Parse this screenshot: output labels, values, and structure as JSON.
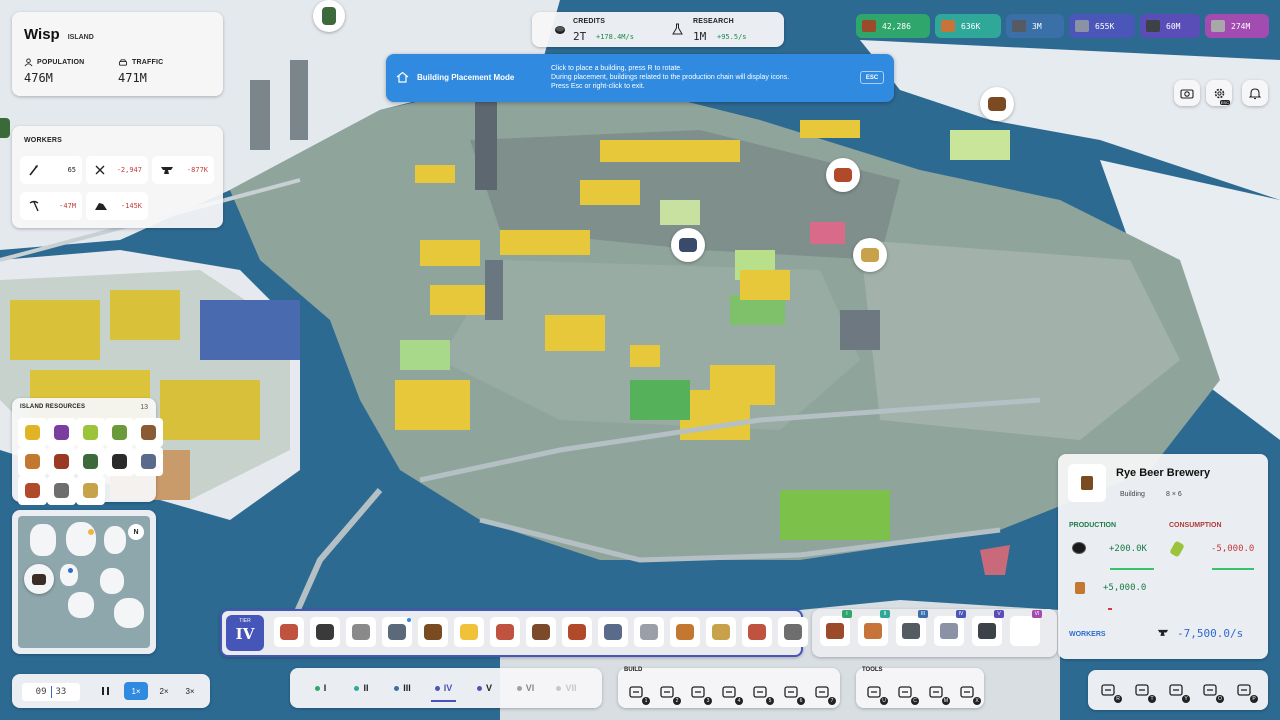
{
  "island": {
    "name": "Wisp",
    "type": "ISLAND",
    "population_label": "POPULATION",
    "population": "476M",
    "traffic_label": "TRAFFIC",
    "traffic": "471M"
  },
  "economy": {
    "credits_label": "CREDITS",
    "credits": "2T",
    "credits_rate": "+178.4M/s",
    "research_label": "RESEARCH",
    "research": "1M",
    "research_rate": "+95.5/s"
  },
  "resources": [
    {
      "value": "42,286",
      "color": "#2fa66b",
      "icon_color": "#9b4a2a",
      "icon": "log-icon"
    },
    {
      "value": "636K",
      "color": "#2fa89a",
      "icon_color": "#c7743a",
      "icon": "planks-icon"
    },
    {
      "value": "3M",
      "color": "#3a6fa8",
      "icon_color": "#555b63",
      "icon": "iron-block-icon"
    },
    {
      "value": "655K",
      "color": "#4b57b8",
      "icon_color": "#8c92a6",
      "icon": "frame-icon"
    },
    {
      "value": "60M",
      "color": "#5b4db8",
      "icon_color": "#3d4249",
      "icon": "steel-beam-icon"
    },
    {
      "value": "274M",
      "color": "#a24bb0",
      "icon_color": "#a8a8a8",
      "icon": "gear-block-icon"
    }
  ],
  "placement": {
    "title": "Building Placement Mode",
    "line1": "Click to place a building, press R to rotate.",
    "line2": "During placement, buildings related to the production chain will display icons.",
    "line3": "Press Esc or right-click to exit.",
    "esc": "ESC"
  },
  "workers": {
    "title": "WORKERS",
    "items": [
      {
        "value": "65",
        "icon": "feather-icon",
        "color": "#222"
      },
      {
        "value": "-2,947",
        "icon": "tools-icon",
        "color": "#c53b3b"
      },
      {
        "value": "-877K",
        "icon": "anvil-icon",
        "color": "#c53b3b"
      },
      {
        "value": "-47M",
        "icon": "pickaxe-icon",
        "color": "#c53b3b"
      },
      {
        "value": "-145K",
        "icon": "ore-pile-icon",
        "color": "#c53b3b"
      }
    ]
  },
  "island_resources": {
    "title": "ISLAND RESOURCES",
    "count": "13",
    "items": [
      {
        "icon": "corn-icon",
        "color": "#e0b424"
      },
      {
        "icon": "grapes-icon",
        "color": "#7a3da0"
      },
      {
        "icon": "wheat-icon",
        "color": "#9cc43a"
      },
      {
        "icon": "herb-icon",
        "color": "#6a9a3a"
      },
      {
        "icon": "wood-log-icon",
        "color": "#8a5a35"
      },
      {
        "icon": "food-bowl-icon",
        "color": "#c2782f"
      },
      {
        "icon": "cocoa-icon",
        "color": "#9a3a25"
      },
      {
        "icon": "barrel-icon",
        "color": "#3d6a3a"
      },
      {
        "icon": "coal-icon",
        "color": "#2a2a2a"
      },
      {
        "icon": "silver-ore-icon",
        "color": "#5a6a8a"
      },
      {
        "icon": "copper-ore-icon",
        "color": "#b04a2a"
      },
      {
        "icon": "stone-icon",
        "color": "#6e6e6e"
      },
      {
        "icon": "gold-ore-icon",
        "color": "#c8a24a"
      }
    ]
  },
  "minimap": {
    "compass": "N"
  },
  "building_info": {
    "name": "Rye Beer Brewery",
    "category": "Building",
    "size": "8 × 6",
    "production_label": "PRODUCTION",
    "consumption_label": "CONSUMPTION",
    "production": [
      {
        "value": "+200.0K",
        "icon": "coal-icon",
        "color": "#1d7a4a"
      },
      {
        "value": "+5,000.0",
        "icon": "beer-icon",
        "color": "#1d7a4a"
      }
    ],
    "consumption": [
      {
        "value": "-5,000.0",
        "icon": "rye-icon",
        "color": "#c53b3b"
      }
    ],
    "workers_label": "WORKERS",
    "workers_value": "-7,500.0/s"
  },
  "build_tier": {
    "label": "TIER",
    "value": "IV"
  },
  "build_items": [
    {
      "icon": "meat-icon",
      "color": "#c0533f"
    },
    {
      "icon": "tools-icon",
      "color": "#3a3a3a"
    },
    {
      "icon": "oven-icon",
      "color": "#8a8a8a"
    },
    {
      "icon": "anchor-icon",
      "color": "#5a6a7a"
    },
    {
      "icon": "beer-mug-icon",
      "color": "#7a4a20"
    },
    {
      "icon": "cheese-icon",
      "color": "#f0c23a"
    },
    {
      "icon": "leather-icon",
      "color": "#c0533f"
    },
    {
      "icon": "barrel-icon",
      "color": "#7a4a2a"
    },
    {
      "icon": "bricks-icon",
      "color": "#b04a2a"
    },
    {
      "icon": "jar-icon",
      "color": "#5a6a8a"
    },
    {
      "icon": "teapot-icon",
      "color": "#9aa0a8"
    },
    {
      "icon": "bread-icon",
      "color": "#c2782f"
    },
    {
      "icon": "pie-icon",
      "color": "#c8a24a"
    },
    {
      "icon": "cake-icon",
      "color": "#c0533f"
    },
    {
      "icon": "castle-icon",
      "color": "#6e6e6e"
    }
  ],
  "construction_items": [
    {
      "icon": "log-icon",
      "color": "#9b4a2a",
      "num": "I"
    },
    {
      "icon": "planks-icon",
      "color": "#c7743a",
      "num": "II"
    },
    {
      "icon": "iron-block-icon",
      "color": "#555b63",
      "num": "III"
    },
    {
      "icon": "frame-icon",
      "color": "#8c92a6",
      "num": "IV"
    },
    {
      "icon": "steel-beam-icon",
      "color": "#3d4249",
      "num": "V"
    },
    {
      "icon": "empty-slot-icon",
      "color": "#ffffff",
      "num": "VI"
    }
  ],
  "time": {
    "day": "09",
    "minute": "33"
  },
  "speeds": [
    "1×",
    "2×",
    "3×"
  ],
  "tiers": [
    "I",
    "II",
    "III",
    "IV",
    "V",
    "VI",
    "VII"
  ],
  "build_menu": {
    "label": "BUILD",
    "hotkeys": [
      "1",
      "2",
      "3",
      "4",
      "5",
      "6",
      "7"
    ]
  },
  "tools_menu": {
    "label": "TOOLS",
    "hotkeys": [
      "U",
      "C",
      "M",
      "X"
    ]
  },
  "right_menu": {
    "hotkeys": [
      "R",
      "T",
      "Y",
      "O",
      "P"
    ]
  },
  "top_right": {
    "camera_key": "",
    "settings_key": "ESC"
  },
  "map_markers": [
    {
      "icon": "coal-icon",
      "color": "#2a2a2a"
    },
    {
      "icon": "copper-ore-icon",
      "color": "#b04a2a"
    },
    {
      "icon": "wood-pile-icon",
      "color": "#7a4a20"
    },
    {
      "icon": "silver-ore-icon",
      "color": "#3a4a6a"
    },
    {
      "icon": "gold-ore-icon",
      "color": "#c8a24a"
    }
  ]
}
